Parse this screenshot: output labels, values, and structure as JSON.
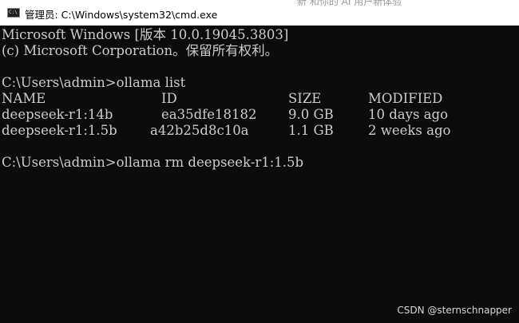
{
  "window": {
    "title": "管理员: C:\\Windows\\system32\\cmd.exe",
    "icon_name": "cmd-icon",
    "icon_glyph": "C:\\",
    "background_title_text": "新  和你的 AI 用户新体验"
  },
  "console": {
    "banner_line1": "Microsoft Windows [版本 10.0.19045.3803]",
    "banner_line2": "(c) Microsoft Corporation。保留所有权利。",
    "command1": "C:\\Users\\admin>ollama list",
    "table": {
      "headers": [
        "NAME",
        "ID",
        "SIZE",
        "MODIFIED"
      ],
      "rows": [
        [
          "deepseek-r1:14b",
          "ea35dfe18182",
          "9.0 GB",
          "10 days ago"
        ],
        [
          "deepseek-r1:1.5b",
          "a42b25d8c10a",
          "1.1 GB",
          "2 weeks ago"
        ]
      ]
    },
    "command2": "C:\\Users\\admin>ollama rm deepseek-r1:1.5b"
  },
  "watermark": "CSDN @sternschnapper",
  "colors": {
    "console_background": "#0c0c0c",
    "console_text": "#cccccc",
    "titlebar_background": "#ffffff"
  }
}
